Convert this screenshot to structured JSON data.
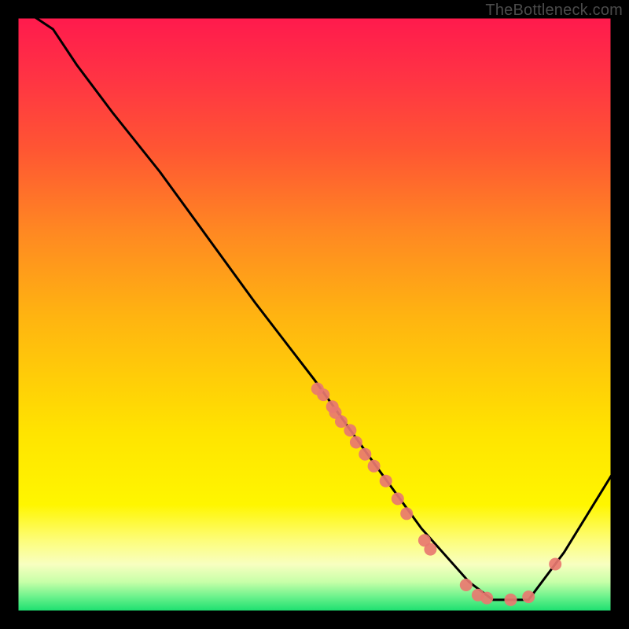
{
  "watermark": "TheBottleneck.com",
  "chart_data": {
    "type": "line",
    "title": "",
    "xlabel": "",
    "ylabel": "",
    "xlim": [
      0,
      100
    ],
    "ylim": [
      0,
      100
    ],
    "curve": {
      "x": [
        3,
        6,
        10,
        16,
        24,
        32,
        40,
        50,
        60,
        68,
        76,
        80,
        86,
        92,
        100
      ],
      "y": [
        100,
        98,
        92,
        84,
        74,
        63,
        52,
        39,
        25,
        14,
        5,
        2,
        2,
        10,
        23
      ]
    },
    "series": [
      {
        "name": "markers",
        "points": [
          {
            "x": 50.5,
            "y": 37.5
          },
          {
            "x": 51.5,
            "y": 36.5
          },
          {
            "x": 53.0,
            "y": 34.5
          },
          {
            "x": 53.5,
            "y": 33.5
          },
          {
            "x": 54.5,
            "y": 32.0
          },
          {
            "x": 56.0,
            "y": 30.5
          },
          {
            "x": 57.0,
            "y": 28.5
          },
          {
            "x": 58.5,
            "y": 26.5
          },
          {
            "x": 60.0,
            "y": 24.5
          },
          {
            "x": 62.0,
            "y": 22.0
          },
          {
            "x": 64.0,
            "y": 19.0
          },
          {
            "x": 65.5,
            "y": 16.5
          },
          {
            "x": 68.5,
            "y": 12.0
          },
          {
            "x": 69.5,
            "y": 10.5
          },
          {
            "x": 75.5,
            "y": 4.5
          },
          {
            "x": 77.5,
            "y": 2.8
          },
          {
            "x": 79.0,
            "y": 2.3
          },
          {
            "x": 83.0,
            "y": 2.0
          },
          {
            "x": 86.0,
            "y": 2.5
          },
          {
            "x": 90.5,
            "y": 8.0
          }
        ]
      }
    ],
    "marker_color": "#e87870"
  }
}
